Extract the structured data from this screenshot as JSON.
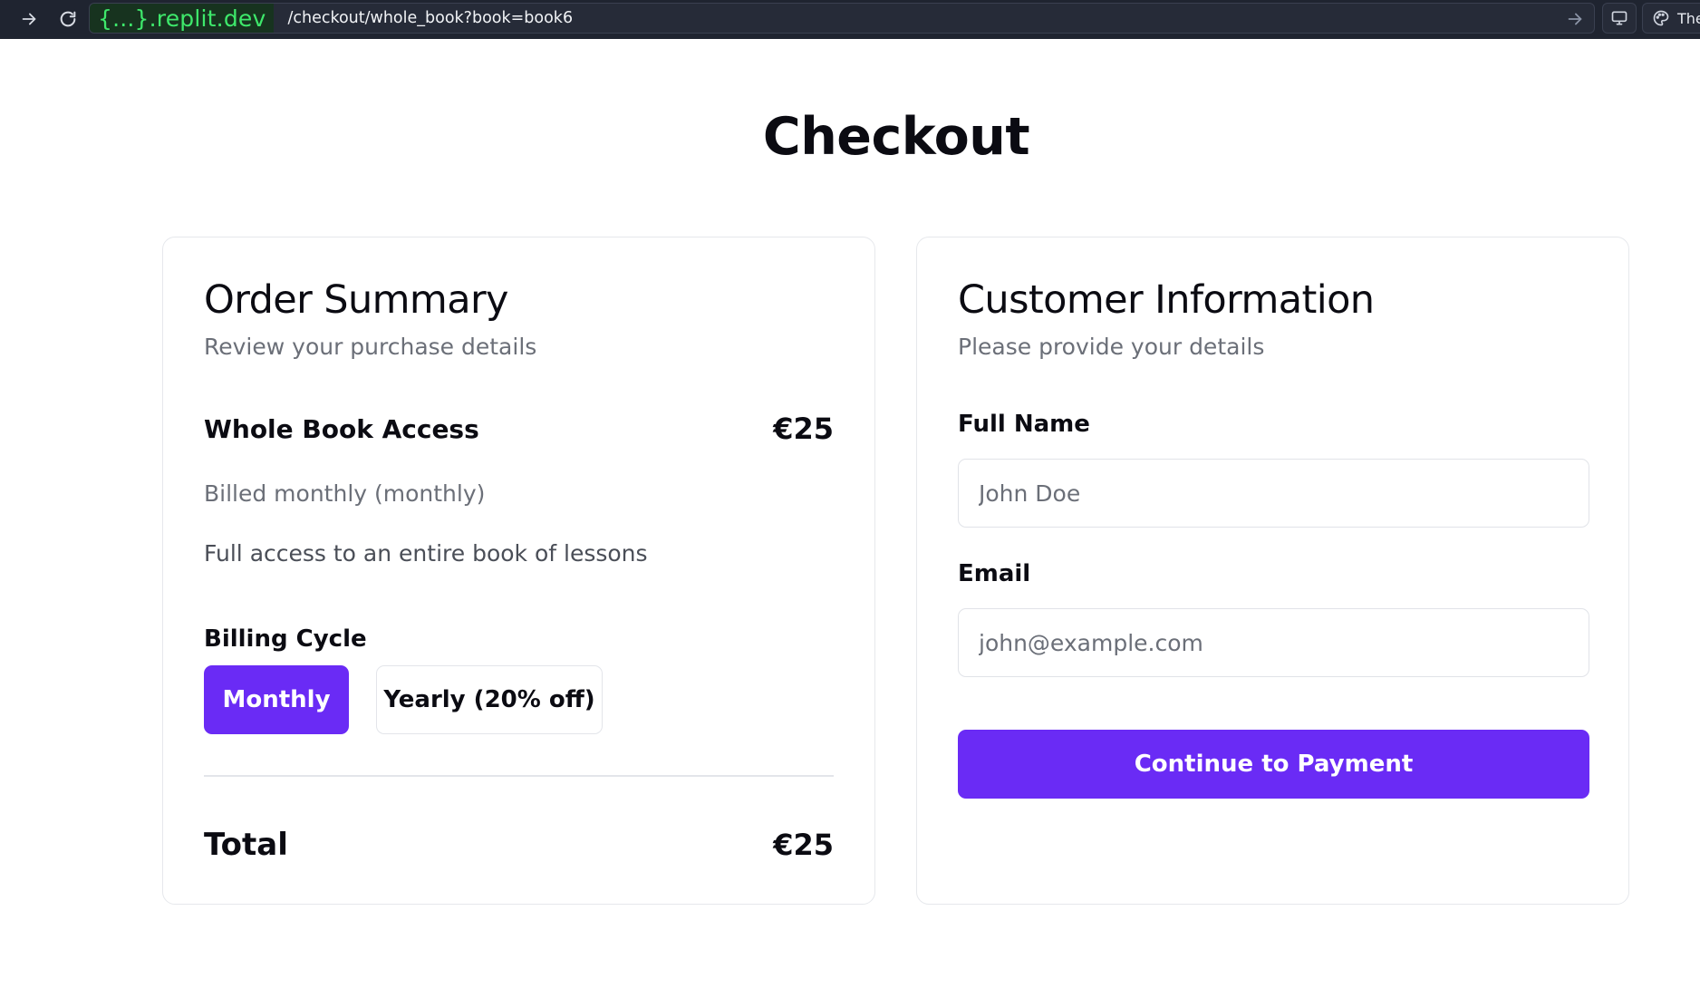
{
  "browser": {
    "domain": "{...}.replit.dev",
    "path": "/checkout/whole_book?book=book6",
    "theme_label": "The"
  },
  "page": {
    "title": "Checkout"
  },
  "order_summary": {
    "title": "Order Summary",
    "subtitle": "Review your purchase details",
    "item_name": "Whole Book Access",
    "item_price": "€25",
    "billing_note": "Billed monthly (monthly)",
    "description": "Full access to an entire book of lessons",
    "billing_cycle_label": "Billing Cycle",
    "cycle_options": {
      "monthly": "Monthly",
      "yearly": "Yearly (20% off)"
    },
    "selected_cycle": "Monthly",
    "total_label": "Total",
    "total_value": "€25"
  },
  "customer_info": {
    "title": "Customer Information",
    "subtitle": "Please provide your details",
    "full_name_label": "Full Name",
    "full_name_placeholder": "John Doe",
    "email_label": "Email",
    "email_placeholder": "john@example.com",
    "submit_label": "Continue to Payment"
  },
  "colors": {
    "accent": "#6a2bf5",
    "browser_bar": "#1f2430",
    "domain_text": "#3ee86b"
  }
}
